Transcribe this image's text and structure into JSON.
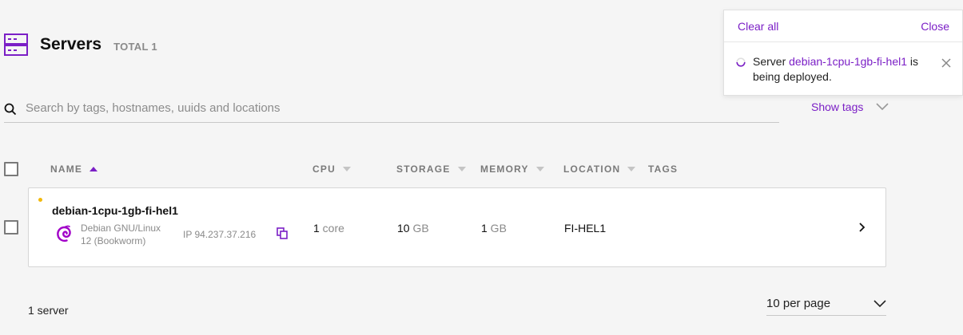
{
  "page": {
    "title": "Servers",
    "total_label": "TOTAL 1"
  },
  "search": {
    "placeholder": "Search by tags, hostnames, uuids and locations",
    "value": ""
  },
  "show_tags_label": "Show tags",
  "table": {
    "columns": [
      {
        "key": "name",
        "label": "NAME",
        "sort": "asc"
      },
      {
        "key": "cpu",
        "label": "CPU",
        "sort": "none"
      },
      {
        "key": "storage",
        "label": "STORAGE",
        "sort": "none"
      },
      {
        "key": "memory",
        "label": "MEMORY",
        "sort": "none"
      },
      {
        "key": "location",
        "label": "LOCATION",
        "sort": "none"
      },
      {
        "key": "tags",
        "label": "TAGS",
        "sort": ""
      }
    ],
    "rows": [
      {
        "hostname": "debian-1cpu-1gb-fi-hel1",
        "status_color": "#f2b90c",
        "os_line1": "Debian GNU/Linux",
        "os_line2": "12 (Bookworm)",
        "ip": "IP 94.237.37.216",
        "cpu_value": "1",
        "cpu_unit": " core",
        "storage_value": "10",
        "storage_unit": " GB",
        "memory_value": "1",
        "memory_unit": " GB",
        "location": "FI-HEL1",
        "os_icon": "debian-swirl-icon"
      }
    ]
  },
  "footer": {
    "count_label": "1 server",
    "per_page_label": "10 per page"
  },
  "notification": {
    "clear_all": "Clear all",
    "close": "Close",
    "msg_prefix": "Server ",
    "msg_server": "debian-1cpu-1gb-fi-hel1",
    "msg_suffix": " is being deployed."
  },
  "colors": {
    "accent": "#7b1fc6",
    "status_pending": "#f2b90c"
  }
}
